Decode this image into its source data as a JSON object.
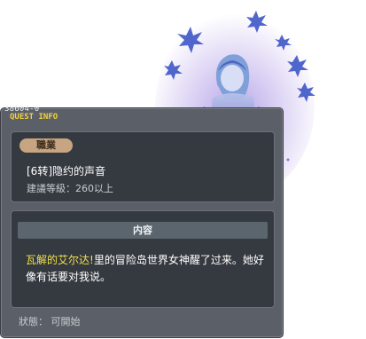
{
  "quest": {
    "id": "38604-0",
    "window_title": "QUEST INFO",
    "job_tag": "職業",
    "name": "[6转]隐约的声音",
    "required_level": "建議等級：260以上",
    "content_header": "内容",
    "content_highlight": "瓦解的艾尔达!",
    "content_rest": "里的冒险岛世界女神醒了过来。她好像有话要对我说。",
    "status": "狀態： 可開始"
  },
  "colors": {
    "window_bg": "#5b6068",
    "panel_bg": "#353a41",
    "title_yellow": "#f3d23a",
    "highlight_yellow": "#f3e04a",
    "job_tag_bg": "#c8a582",
    "content_header_bg": "#5a656e"
  }
}
